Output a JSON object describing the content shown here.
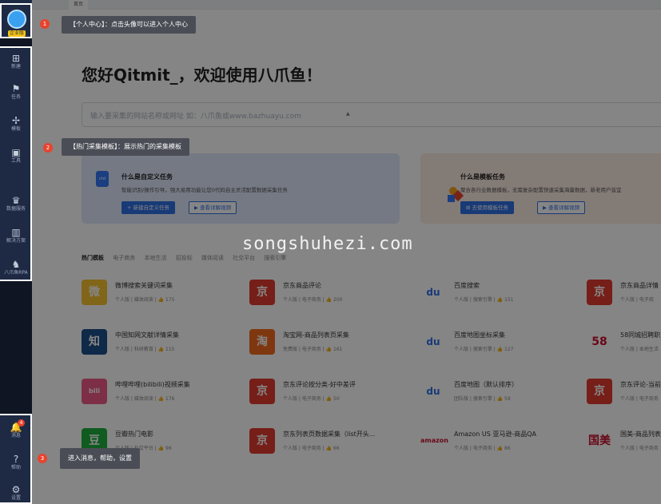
{
  "tabbar": {
    "tab": "首页"
  },
  "sidebar": {
    "avatar_tag": "企业版",
    "items": [
      {
        "label": "新建",
        "icon": "plus-square-icon"
      },
      {
        "label": "任务",
        "icon": "flag-icon"
      },
      {
        "label": "模板",
        "icon": "pinwheel-icon"
      },
      {
        "label": "工具",
        "icon": "toolbox-icon"
      },
      {
        "label": "数据服务",
        "icon": "crown-icon"
      },
      {
        "label": "解决方案",
        "icon": "columns-icon"
      },
      {
        "label": "八爪鱼RPA",
        "icon": "robot-icon"
      }
    ],
    "bottom": [
      {
        "label": "消息",
        "icon": "bell-icon",
        "badge": "4"
      },
      {
        "label": "帮助",
        "icon": "help-icon"
      },
      {
        "label": "设置",
        "icon": "gear-icon"
      }
    ]
  },
  "main": {
    "greeting": "您好Qitmit_，欢迎使用八爪鱼！",
    "search_placeholder": "输入要采集的网站名称或网址 如：八爪鱼或www.bazhuayu.com",
    "cards": [
      {
        "title": "什么是自定义任务",
        "desc": "智能识别/操作引导，强大易用功能让您0代码自主灵活配置数据采集任务",
        "btn1": "+ 新建自定义任务",
        "btn2": "▶ 查看详解视频"
      },
      {
        "title": "什么是模板任务",
        "desc": "聚合各行业数据模板，无需复杂配置快速采集海量数据，新老用户皆宜",
        "btn1": "⊞ 去使用模板任务",
        "btn2": "▶ 查看详解视频"
      }
    ],
    "hot_tabs": [
      "热门模板",
      "电子商务",
      "本地生活",
      "招投标",
      "媒体阅读",
      "社交平台",
      "搜索引擎"
    ],
    "templates": [
      {
        "name": "微博搜索关键词采集",
        "meta": "个人版 | 媒体阅读 | 👍 175",
        "color": "#f7c22e",
        "glyph": "微"
      },
      {
        "name": "京东商品评论",
        "meta": "个人版 | 电子商务 | 👍 200",
        "color": "#e23a2e",
        "glyph": "京"
      },
      {
        "name": "百度搜索",
        "meta": "个人版 | 搜索引擎 | 👍 151",
        "color": "#2f6fe4",
        "glyph": "du"
      },
      {
        "name": "京东商品详情",
        "meta": "个人版 | 电子商",
        "color": "#e23a2e",
        "glyph": "京"
      },
      {
        "name": "中国知网文献详情采集",
        "meta": "个人版 | 科研教育 | 👍 115",
        "color": "#1d4f8a",
        "glyph": "知"
      },
      {
        "name": "淘宝网-商品列表页采集",
        "meta": "免费版 | 电子商务 | 👍 161",
        "color": "#f46a1e",
        "glyph": "淘"
      },
      {
        "name": "百度地图坐标采集",
        "meta": "个人版 | 搜索引擎 | 👍 127",
        "color": "#2f6fe4",
        "glyph": "du"
      },
      {
        "name": "58同城招聘职",
        "meta": "个人版 | 本地生活",
        "color": "#ffffff",
        "glyph": "58"
      },
      {
        "name": "哔哩哔哩(bilibili)视频采集",
        "meta": "个人版 | 媒体阅读 | 👍 176",
        "color": "#f05b8a",
        "glyph": "bili"
      },
      {
        "name": "京东评论按分类-好中差评",
        "meta": "个人版 | 电子商务 | 👍 50",
        "color": "#e23a2e",
        "glyph": "京"
      },
      {
        "name": "百度地图（默认排序）",
        "meta": "团队版 | 搜索引擎 | 👍 59",
        "color": "#2f6fe4",
        "glyph": "du"
      },
      {
        "name": "京东评论-当前",
        "meta": "个人版 | 电子商务",
        "color": "#e23a2e",
        "glyph": "京"
      },
      {
        "name": "豆瓣热门电影",
        "meta": "个人版 | 社交平台 | 👍 96",
        "color": "#1fae3c",
        "glyph": "豆"
      },
      {
        "name": "京东列表页数据采集（list开头...",
        "meta": "个人版 | 电子商务 | 👍 66",
        "color": "#e23a2e",
        "glyph": "京"
      },
      {
        "name": "Amazon US 亚马逊-商品QA",
        "meta": "个人版 | 电子商务 | 👍 86",
        "color": "#ffffff",
        "glyph": "amazon"
      },
      {
        "name": "国美-商品列表",
        "meta": "个人版 | 电子商务",
        "color": "#ffffff",
        "glyph": "国美"
      }
    ]
  },
  "guide": {
    "tip1": "【个人中心】：点击头像可以进入个人中心",
    "tip2": "【热门采集模板】：展示热门的采集模板",
    "tip3": "进入消息，帮助，设置",
    "n1": "1",
    "n2": "2",
    "n3": "3"
  },
  "watermark": "songshuhezi.com"
}
